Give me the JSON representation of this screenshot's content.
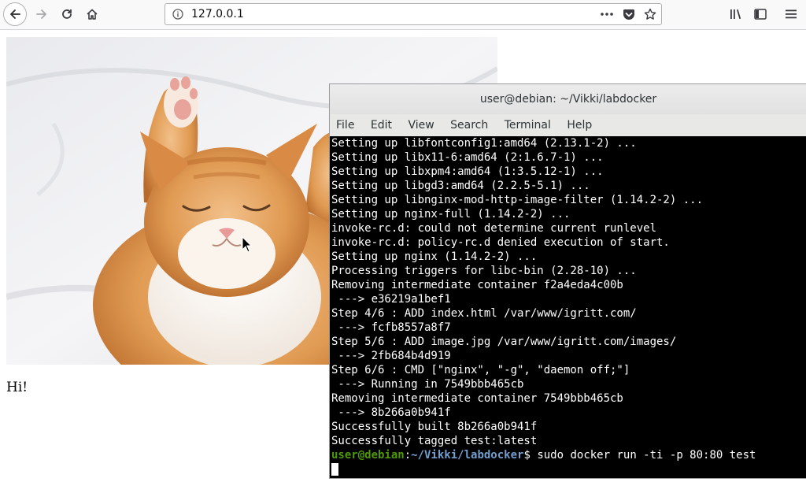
{
  "browser": {
    "url": "127.0.0.1"
  },
  "page": {
    "text": "Hi!"
  },
  "terminal": {
    "title": "user@debian: ~/Vikki/labdocker",
    "menu": [
      "File",
      "Edit",
      "View",
      "Search",
      "Terminal",
      "Help"
    ],
    "lines": [
      "Setting up libfontconfig1:amd64 (2.13.1-2) ...",
      "Setting up libx11-6:amd64 (2:1.6.7-1) ...",
      "Setting up libxpm4:amd64 (1:3.5.12-1) ...",
      "Setting up libgd3:amd64 (2.2.5-5.1) ...",
      "Setting up libnginx-mod-http-image-filter (1.14.2-2) ...",
      "Setting up nginx-full (1.14.2-2) ...",
      "invoke-rc.d: could not determine current runlevel",
      "invoke-rc.d: policy-rc.d denied execution of start.",
      "Setting up nginx (1.14.2-2) ...",
      "Processing triggers for libc-bin (2.28-10) ...",
      "Removing intermediate container f2a4eda4c00b",
      " ---> e36219a1bef1",
      "Step 4/6 : ADD index.html /var/www/igritt.com/",
      " ---> fcfb8557a8f7",
      "Step 5/6 : ADD image.jpg /var/www/igritt.com/images/",
      " ---> 2fb684b4d919",
      "Step 6/6 : CMD [\"nginx\", \"-g\", \"daemon off;\"]",
      " ---> Running in 7549bbb465cb",
      "Removing intermediate container 7549bbb465cb",
      " ---> 8b266a0b941f",
      "Successfully built 8b266a0b941f",
      "Successfully tagged test:latest"
    ],
    "prompt": {
      "user": "user@debian",
      "sep": ":",
      "path": "~/Vikki/labdocker",
      "symbol": "$",
      "command": " sudo docker run -ti -p 80:80 test"
    }
  },
  "icons": {
    "back": "back-arrow-icon",
    "forward": "forward-arrow-icon",
    "reload": "reload-icon",
    "home": "home-icon",
    "page_actions": "more-icon",
    "pocket": "pocket-icon",
    "bookmark": "star-icon",
    "library": "library-icon",
    "sidebar": "sidebar-icon",
    "menu": "hamburger-icon"
  }
}
